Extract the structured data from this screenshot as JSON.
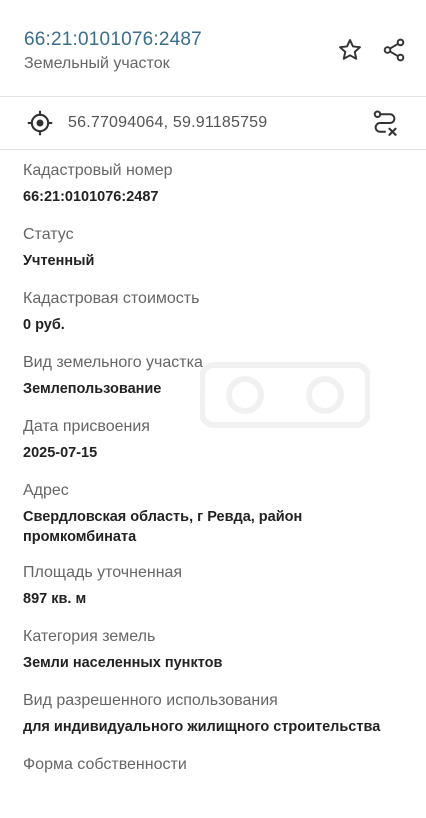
{
  "header": {
    "title": "66:21:0101076:2487",
    "subtitle": "Земельный участок",
    "icons": [
      "star-icon",
      "share-icon"
    ]
  },
  "coordinates": {
    "text": "56.77094064, 59.91185759",
    "icons": [
      "location-target-icon",
      "route-icon"
    ]
  },
  "fields": [
    {
      "label": "Кадастровый номер",
      "value": "66:21:0101076:2487"
    },
    {
      "label": "Статус",
      "value": "Учтенный"
    },
    {
      "label": "Кадастровая стоимость",
      "value": "0 руб."
    },
    {
      "label": "Вид земельного участка",
      "value": "Землепользование"
    },
    {
      "label": "Дата присвоения",
      "value": "2025-07-15"
    },
    {
      "label": "Адрес",
      "value": "Свердловская область, г Ревда, район промкомбината"
    },
    {
      "label": "Площадь уточненная",
      "value": "897 кв. м"
    },
    {
      "label": "Категория земель",
      "value": "Земли населенных пунктов"
    },
    {
      "label": "Вид разрешенного использования",
      "value": "для индивидуального жилищного строительства"
    },
    {
      "label": "Форма собственности",
      "value": ""
    }
  ],
  "colors": {
    "title": "#3a6f8a",
    "label": "#666666",
    "value": "#222222",
    "divider": "#e3e3e3"
  }
}
